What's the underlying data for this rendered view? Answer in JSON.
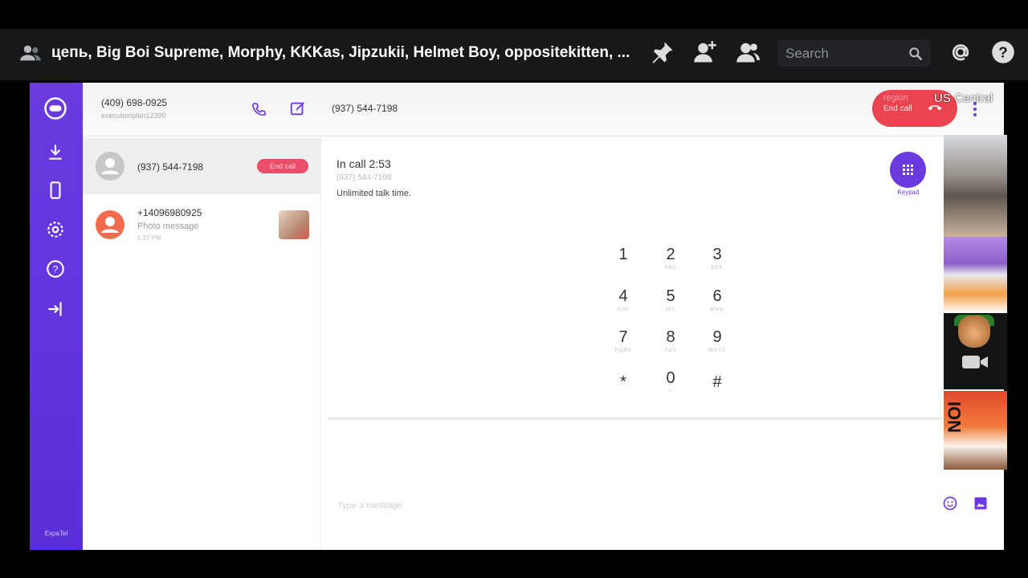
{
  "discord": {
    "group_title": "цепь, Big Boi Supreme, Morphy, KKKas, Jipzukii, Helmet Boy, oppositekitten, ...",
    "search_placeholder": "Search",
    "icons": [
      "users-icon",
      "pin-icon",
      "add-friend-icon",
      "members-icon",
      "search-icon",
      "mention-icon",
      "help-icon"
    ]
  },
  "app": {
    "sidebar_footer": "ExpaTel",
    "my_number": "(409) 698-0925",
    "my_username": "executionplan12390",
    "header_peer": "(937) 544-7198",
    "header_end_call": "End call",
    "region_label": "region",
    "region_value": "US Central",
    "accent": "#6a3ae0",
    "end_call_color": "#e94450"
  },
  "conversations": [
    {
      "number": "(937) 544-7198",
      "badge": "End call"
    },
    {
      "number": "+14096980925",
      "preview": "Photo message",
      "time": "5:27 PM"
    }
  ],
  "call": {
    "status": "In call 2:53",
    "number": "(937) 544-7198",
    "note": "Unlimited talk time.",
    "keypad_label": "Keypad"
  },
  "keypad": [
    {
      "digit": "1",
      "letters": ""
    },
    {
      "digit": "2",
      "letters": "ABC"
    },
    {
      "digit": "3",
      "letters": "DEF"
    },
    {
      "digit": "4",
      "letters": "GHI"
    },
    {
      "digit": "5",
      "letters": "JKL"
    },
    {
      "digit": "6",
      "letters": "MNO"
    },
    {
      "digit": "7",
      "letters": "PQRS"
    },
    {
      "digit": "8",
      "letters": "TUV"
    },
    {
      "digit": "9",
      "letters": "WXYZ"
    },
    {
      "digit": "*",
      "letters": ""
    },
    {
      "digit": "0",
      "letters": "+"
    },
    {
      "digit": "#",
      "letters": ""
    }
  ],
  "composer": {
    "placeholder": "Type a message"
  },
  "tiles": {
    "tile4_text": "NOI"
  }
}
